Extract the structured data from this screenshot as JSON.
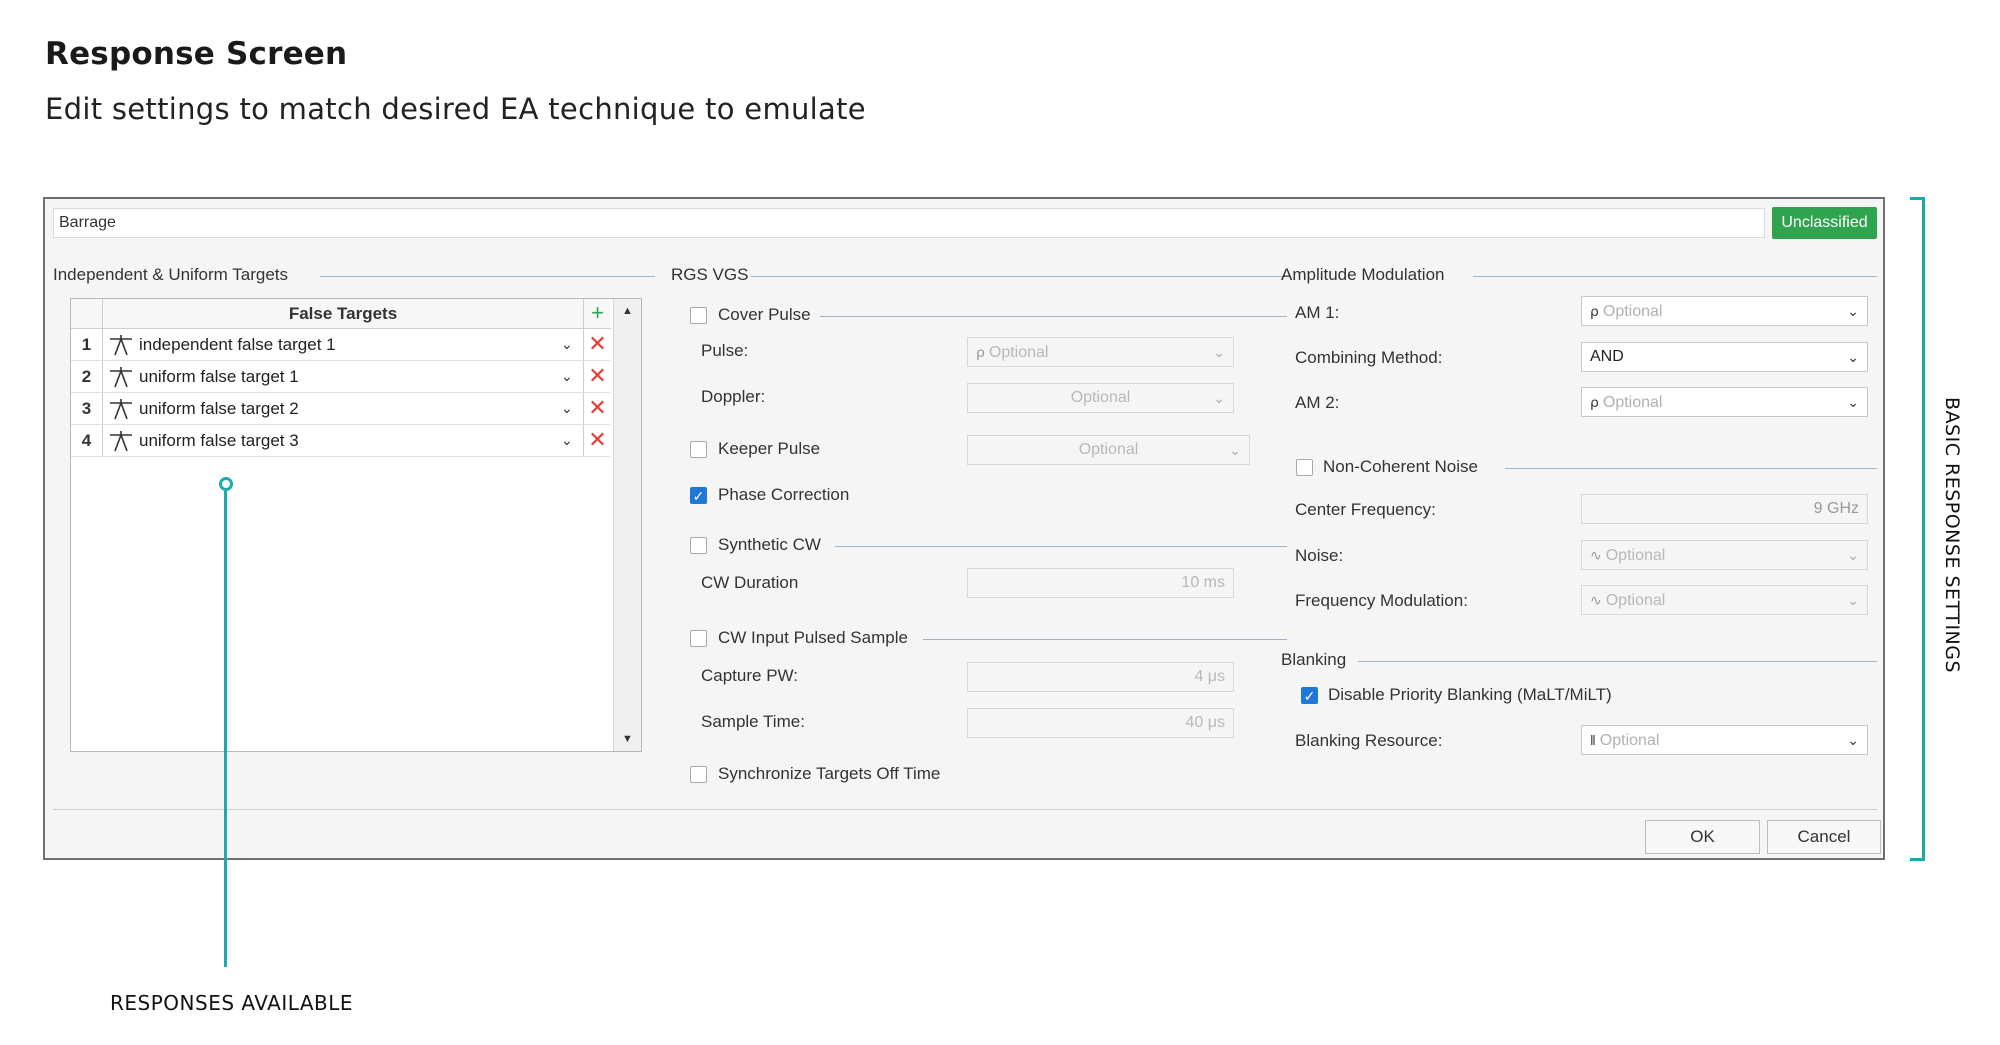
{
  "page": {
    "title": "Response Screen",
    "subtitle": "Edit settings to match desired EA technique to emulate"
  },
  "dialog": {
    "name_value": "Barrage",
    "classification": "Unclassified",
    "targets_group": {
      "title": "Independent & Uniform Targets",
      "table_header": "False Targets",
      "add_symbol": "+",
      "rows": [
        {
          "index": "1",
          "name": "independent false target 1"
        },
        {
          "index": "2",
          "name": "uniform false target 1"
        },
        {
          "index": "3",
          "name": "uniform false target 2"
        },
        {
          "index": "4",
          "name": "uniform false target 3"
        }
      ],
      "delete_symbol": "✕"
    },
    "rgs_vgs": {
      "title": "RGS VGS",
      "cover_pulse": {
        "label": "Cover Pulse",
        "checked": false
      },
      "pulse": {
        "label": "Pulse:",
        "value": "Optional"
      },
      "doppler": {
        "label": "Doppler:",
        "value": "Optional"
      },
      "keeper_pulse": {
        "label": "Keeper Pulse",
        "checked": false,
        "value": "Optional"
      },
      "phase_correction": {
        "label": "Phase Correction",
        "checked": true
      },
      "synthetic_cw": {
        "label": "Synthetic CW",
        "checked": false
      },
      "cw_duration": {
        "label": "CW Duration",
        "value": "10 ms"
      },
      "cw_input_pulsed_sample": {
        "label": "CW Input Pulsed Sample",
        "checked": false
      },
      "capture_pw": {
        "label": "Capture PW:",
        "value": "4 μs"
      },
      "sample_time": {
        "label": "Sample Time:",
        "value": "40 μs"
      },
      "synchronize_targets": {
        "label": "Synchronize Targets Off Time",
        "checked": false
      }
    },
    "amplitude_modulation": {
      "title": "Amplitude Modulation",
      "am1": {
        "label": "AM 1:",
        "value": "Optional"
      },
      "combining_method": {
        "label": "Combining Method:",
        "value": "AND"
      },
      "am2": {
        "label": "AM 2:",
        "value": "Optional"
      },
      "non_coherent_noise": {
        "label": "Non-Coherent Noise",
        "checked": false
      },
      "center_frequency": {
        "label": "Center Frequency:",
        "value": "9 GHz"
      },
      "noise": {
        "label": "Noise:",
        "value": "Optional"
      },
      "frequency_modulation": {
        "label": "Frequency Modulation:",
        "value": "Optional"
      }
    },
    "blanking": {
      "title": "Blanking",
      "disable_priority": {
        "label": "Disable Priority Blanking (MaLT/MiLT)",
        "checked": true
      },
      "blanking_resource": {
        "label": "Blanking Resource:",
        "value": "Optional"
      }
    },
    "buttons": {
      "ok": "OK",
      "cancel": "Cancel"
    }
  },
  "annotations": {
    "responses_available": "RESPONSES AVAILABLE",
    "basic_response_settings": "BASIC RESPONSE SETTINGS",
    "accent_color": "#1aabaa"
  },
  "colors": {
    "badge": "#2ea44f",
    "checkbox_on": "#1e78d7",
    "delete": "#e53935",
    "add": "#2ea44f"
  }
}
